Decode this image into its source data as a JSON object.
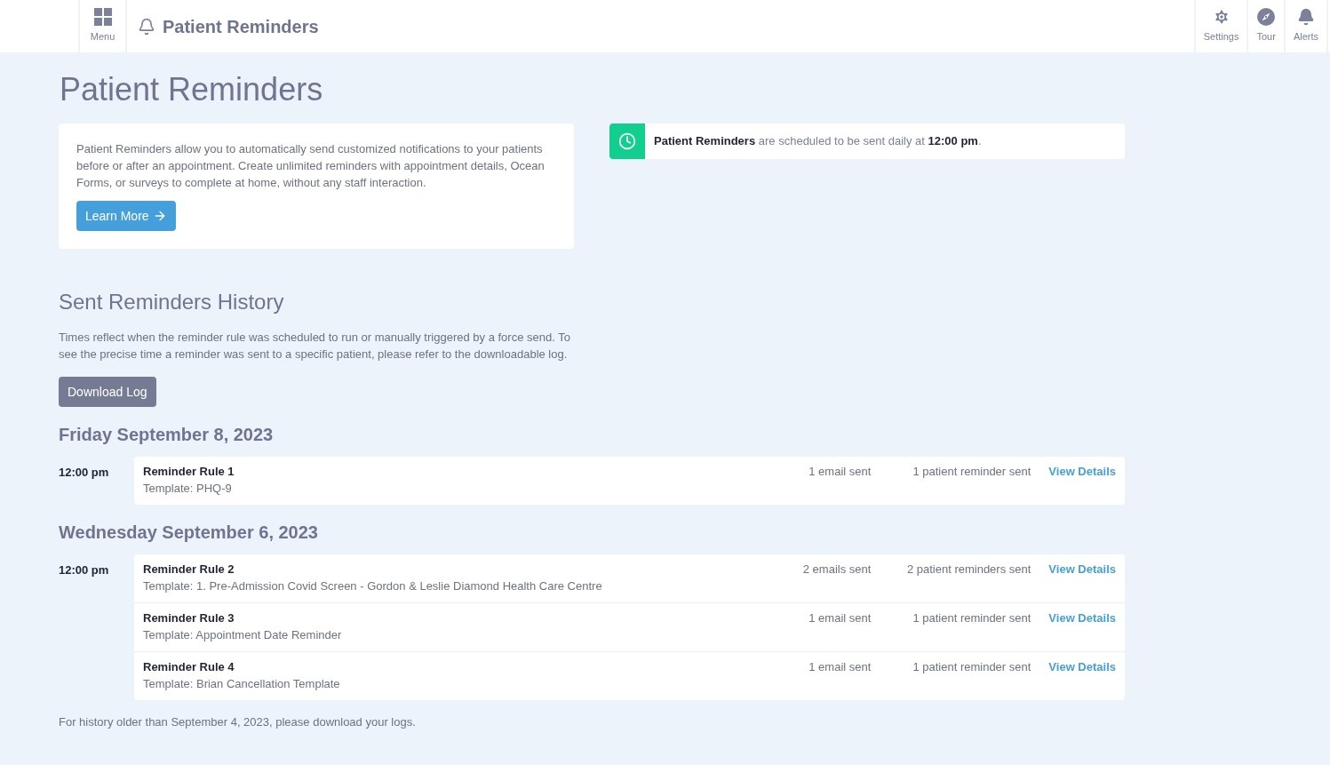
{
  "header": {
    "menu_label": "Menu",
    "title": "Patient Reminders",
    "actions": [
      {
        "kind": "settings",
        "label": "Settings"
      },
      {
        "kind": "tour",
        "label": "Tour"
      },
      {
        "kind": "alerts",
        "label": "Alerts"
      }
    ]
  },
  "page_title": "Patient Reminders",
  "intro": {
    "text": "Patient Reminders allow you to automatically send customized notifications to your patients before or after an appointment. Create unlimited reminders with appointment details, Ocean Forms, or surveys to complete at home, without any staff interaction.",
    "button": "Learn More"
  },
  "schedule_notice": "**Patient Reminders** are scheduled to be sent daily at **12:00 pm**.",
  "history": {
    "title": "Sent Reminders History",
    "description": "Times reflect when the reminder rule was scheduled to run or manually triggered by a force send. To see the precise time a reminder was sent to a specific patient, please refer to the downloadable log.",
    "button": "Download Log",
    "days": [
      {
        "date": "Friday September 8, 2023",
        "time": "12:00 pm",
        "rules": [
          {
            "name": "Reminder Rule 1",
            "template": "Template: PHQ-9",
            "emails": "1 email sent",
            "reminders": "1 patient reminder sent",
            "link": "View Details"
          }
        ]
      },
      {
        "date": "Wednesday September 6, 2023",
        "time": "12:00 pm",
        "rules": [
          {
            "name": "Reminder Rule 2",
            "template": "Template: 1. Pre-Admission Covid Screen - Gordon & Leslie Diamond Health Care Centre",
            "emails": "2 emails sent",
            "reminders": "2 patient reminders sent",
            "link": "View Details"
          },
          {
            "name": "Reminder Rule 3",
            "template": "Template: Appointment Date Reminder",
            "emails": "1 email sent",
            "reminders": "1 patient reminder sent",
            "link": "View Details"
          },
          {
            "name": "Reminder Rule 4",
            "template": "Template: Brian Cancellation Template",
            "emails": "1 email sent",
            "reminders": "1 patient reminder sent",
            "link": "View Details"
          }
        ]
      }
    ],
    "footer": "For history older than September 4, 2023, please download your logs."
  }
}
